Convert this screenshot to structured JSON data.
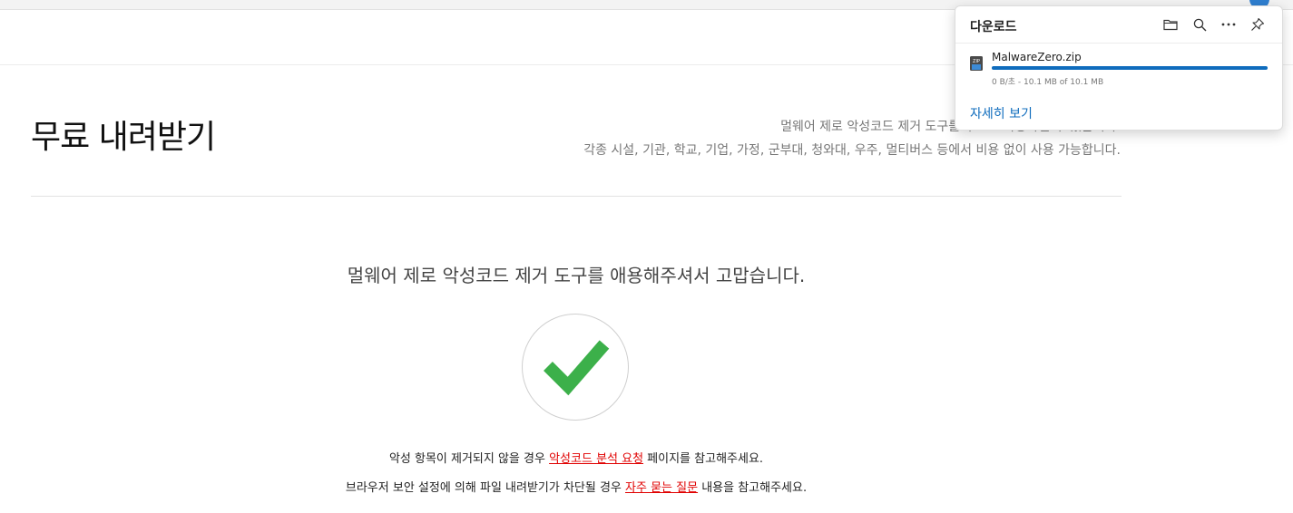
{
  "page": {
    "title": "무료 내려받기",
    "description_line1": "멀웨어 제로 악성코드 제거 도구를 무료로 사용하실 수 있습니다.",
    "description_line2": "각종 시설, 기관, 학교, 기업, 가정, 군부대, 청와대, 우주, 멀티버스 등에서 비용 없이 사용 가능합니다.",
    "thanks_message": "멀웨어 제로 악성코드 제거 도구를 애용해주셔서 고맙습니다.",
    "check_color": "#3cb04a",
    "note1": {
      "prefix": "악성 항목이 제거되지 않을 경우 ",
      "link": "악성코드 분석 요청",
      "suffix": " 페이지를 참고해주세요."
    },
    "note2": {
      "prefix": "브라우저 보안 설정에 의해 파일 내려받기가 차단될 경우 ",
      "link": "자주 묻는 질문",
      "suffix": " 내용을 참고해주세요."
    },
    "link_color": "#e00000"
  },
  "downloads": {
    "title": "다운로드",
    "tools": [
      "folder-icon",
      "search-icon",
      "more-icon",
      "pin-icon"
    ],
    "item": {
      "file_name": "MalwareZero.zip",
      "status": "0 B/초 - 10.1 MB of 10.1 MB",
      "progress_percent": 100,
      "icon": "zip-file-icon"
    },
    "details_link": "자세히 보기",
    "accent": "#0f6cbd"
  }
}
